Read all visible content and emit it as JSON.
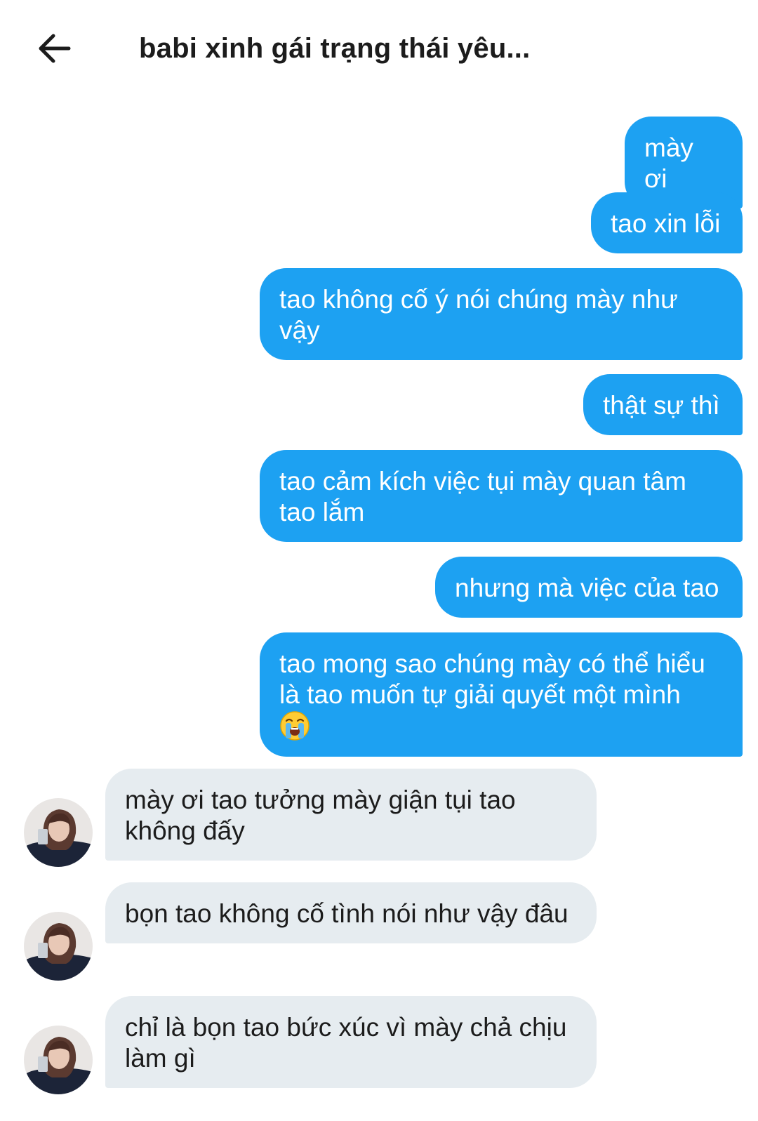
{
  "header": {
    "title": "babi xinh gái trạng thái yêu..."
  },
  "icons": {
    "back": "arrow-left-icon",
    "emoji": "loudly-crying-face-emoji",
    "avatar": "contact-avatar"
  },
  "colors": {
    "outgoing_bubble": "#1da1f2",
    "incoming_bubble": "#e6ecf0"
  },
  "messages": {
    "outgoing": [
      "mày ơi",
      "tao xin lỗi",
      "tao không cố ý nói chúng mày như vậy",
      "thật sự thì",
      "tao cảm kích việc tụi mày quan tâm tao lắm",
      "nhưng mà việc của tao",
      "tao mong sao chúng mày có thể hiểu là tao muốn tự giải quyết một mình"
    ],
    "incoming": [
      "mày ơi tao tưởng mày giận tụi tao không đấy",
      "bọn tao không cố tình nói như vậy đâu",
      "chỉ là bọn tao bức xúc vì mày chả chịu làm gì"
    ]
  }
}
